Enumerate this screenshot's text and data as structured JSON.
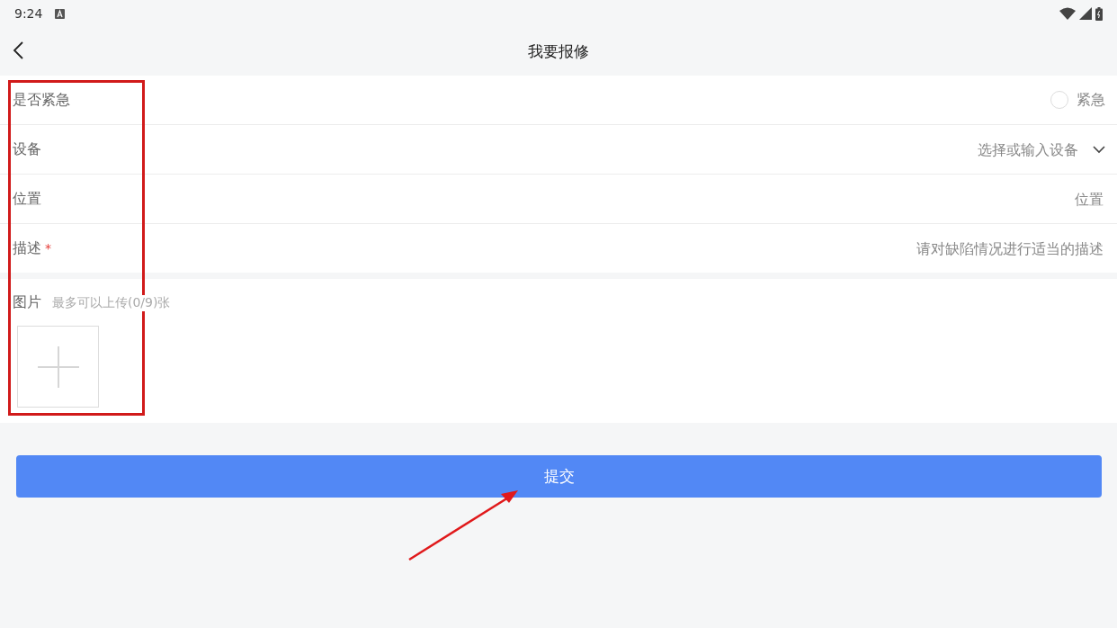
{
  "status_bar": {
    "time": "9:24"
  },
  "nav": {
    "title": "我要报修"
  },
  "form": {
    "rows": [
      {
        "kind": "radio",
        "label": "是否紧急",
        "option": "紧急",
        "checked": false
      },
      {
        "kind": "select",
        "label": "设备",
        "placeholder": "选择或输入设备"
      },
      {
        "kind": "input",
        "label": "位置",
        "placeholder": "位置"
      },
      {
        "kind": "input",
        "label": "描述",
        "required": true,
        "required_mark": "*",
        "placeholder": "请对缺陷情况进行适当的描述"
      }
    ]
  },
  "pictures": {
    "label": "图片",
    "hint": "最多可以上传(0/9)张"
  },
  "submit": {
    "label": "提交"
  },
  "annotations": {
    "highlight_box": true,
    "arrow": true
  }
}
